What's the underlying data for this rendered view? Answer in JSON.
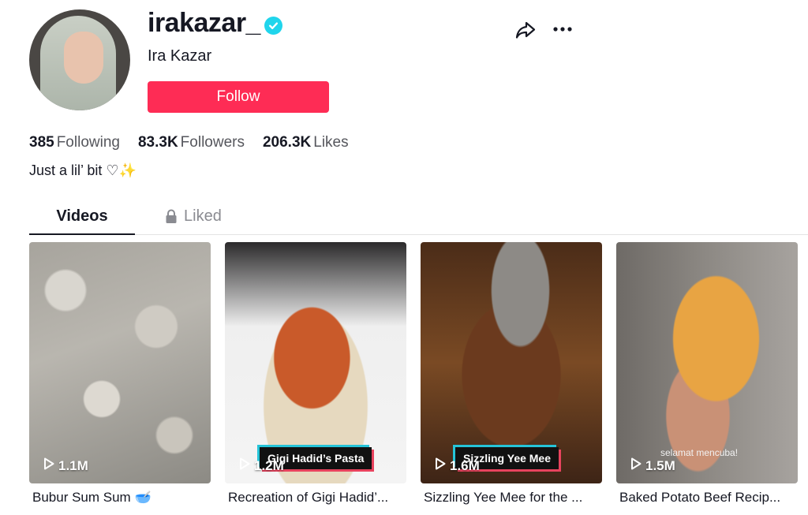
{
  "profile": {
    "username": "irakazar_",
    "nickname": "Ira Kazar",
    "follow_label": "Follow",
    "bio": "Just a lil’ bit ♡✨"
  },
  "stats": [
    {
      "value": "385",
      "label": "Following"
    },
    {
      "value": "83.3K",
      "label": "Followers"
    },
    {
      "value": "206.3K",
      "label": "Likes"
    }
  ],
  "tabs": {
    "videos": "Videos",
    "liked": "Liked"
  },
  "icons": {
    "verified": "verified-badge-icon",
    "share": "share-icon",
    "more": "more-icon",
    "lock": "lock-icon",
    "play": "play-icon"
  },
  "colors": {
    "accent": "#fe2c55",
    "verified": "#20d5ec"
  },
  "videos": [
    {
      "views": "1.1M",
      "overlay": "",
      "sticker": "",
      "caption": "Bubur Sum Sum 🥣"
    },
    {
      "views": "1.2M",
      "overlay": "Gigi Hadid’s Pasta",
      "sticker": "",
      "caption": "Recreation of Gigi Hadid’..."
    },
    {
      "views": "1.6M",
      "overlay": "Sizzling Yee Mee",
      "sticker": "",
      "caption": "Sizzling Yee Mee for the ..."
    },
    {
      "views": "1.5M",
      "overlay": "",
      "sticker": "selamat mencuba!",
      "caption": "Baked Potato Beef Recip..."
    }
  ]
}
